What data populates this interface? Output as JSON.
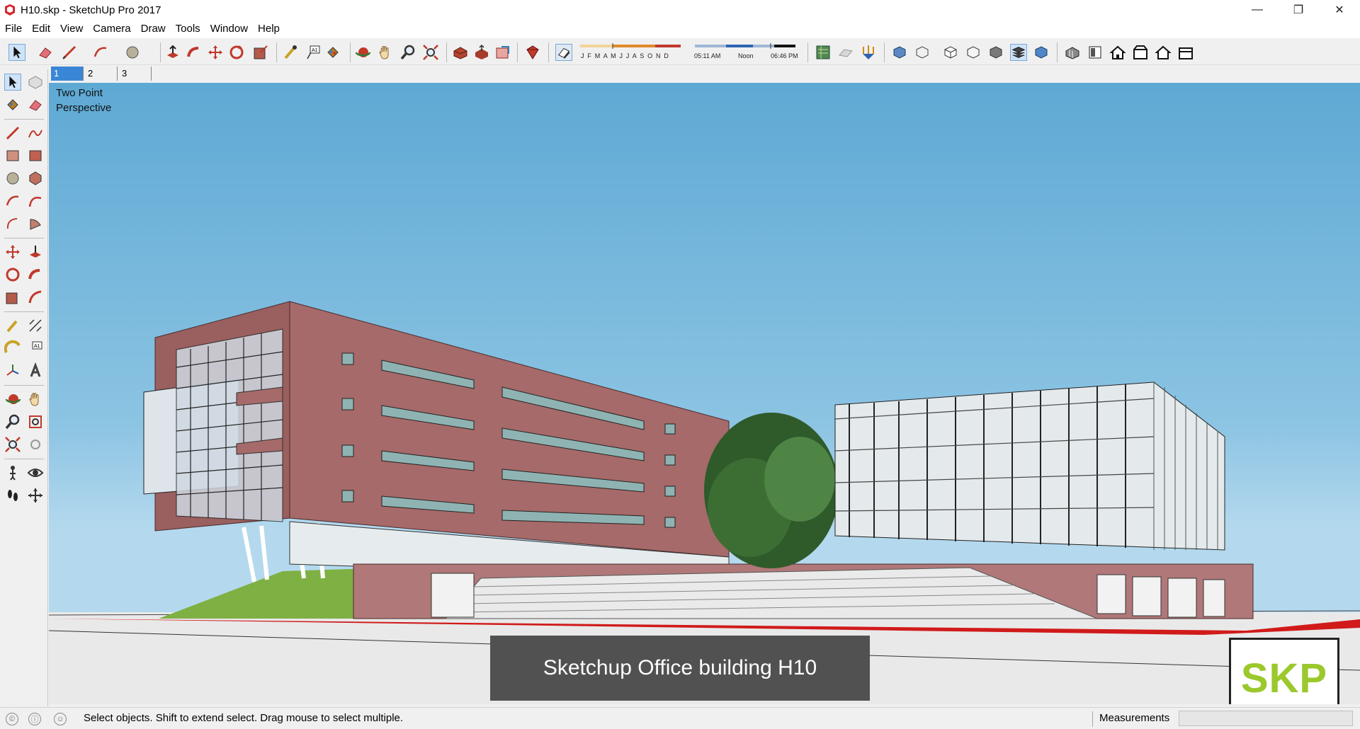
{
  "window": {
    "title": "H10.skp - SketchUp Pro 2017",
    "minimize_glyph": "—",
    "restore_glyph": "❐",
    "close_glyph": "✕"
  },
  "menu": [
    "File",
    "Edit",
    "View",
    "Camera",
    "Draw",
    "Tools",
    "Window",
    "Help"
  ],
  "toolbar": {
    "shadow_months": "J F M A M J J A S O N D",
    "time_start": "05:11 AM",
    "time_noon": "Noon",
    "time_end": "06:46 PM"
  },
  "scenes": [
    "1",
    "2",
    "3"
  ],
  "active_scene": "1",
  "viewport": {
    "view_label_line1": "Two Point",
    "view_label_line2": "Perspective",
    "caption": "Sketchup Office building H10",
    "logo": "SKP"
  },
  "status": {
    "message": "Select objects. Shift to extend select. Drag mouse to select multiple.",
    "measurements_label": "Measurements"
  },
  "colors": {
    "sky_top": "#5ea9d4",
    "facade": "#a86a6a",
    "logo_green": "#9bc82c",
    "active_tab": "#3a86d6"
  }
}
